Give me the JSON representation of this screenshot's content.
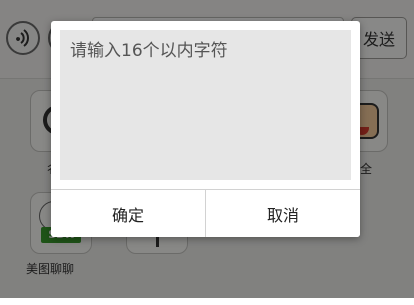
{
  "chat_input_bar": {
    "send_label": "发送"
  },
  "apps": {
    "visible_labels": [
      "美图聊聊"
    ],
    "partial_left_label": "彳",
    "partial_right_label": "全",
    "sdk_badge": "SDK"
  },
  "dialog": {
    "input_placeholder": "请输入16个以内字符",
    "ok_label": "确定",
    "cancel_label": "取消"
  },
  "colors": {
    "overlay": "rgba(0,0,0,0.45)",
    "dialog_bg": "#ffffff",
    "input_bg": "#e6e6e6",
    "sdk_green": "#3a9a2c"
  }
}
